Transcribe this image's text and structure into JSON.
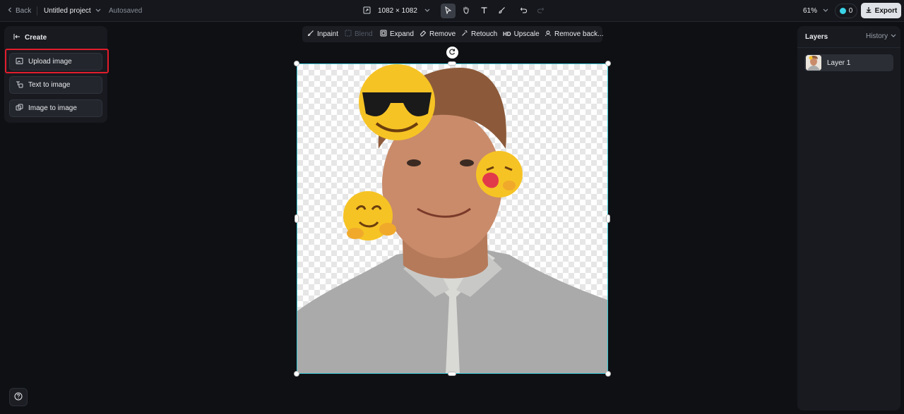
{
  "topbar": {
    "back_label": "Back",
    "project_name": "Untitled project",
    "autosaved": "Autosaved",
    "canvas_size": "1082 × 1082",
    "zoom": "61%",
    "credits": "0",
    "export_label": "Export"
  },
  "create": {
    "title": "Create",
    "items": [
      {
        "label": "Upload image"
      },
      {
        "label": "Text to image"
      },
      {
        "label": "Image to image"
      }
    ]
  },
  "edit_toolbar": {
    "inpaint": "Inpaint",
    "blend": "Blend",
    "expand": "Expand",
    "remove": "Remove",
    "retouch": "Retouch",
    "upscale_badge": "HD",
    "upscale": "Upscale",
    "remove_background": "Remove back..."
  },
  "layers": {
    "title": "Layers",
    "history_label": "History",
    "items": [
      {
        "label": "Layer 1"
      }
    ]
  },
  "colors": {
    "selection_border": "#3cc8d6",
    "highlight_box": "#e11d2b",
    "accent": "#3ad3e6"
  }
}
